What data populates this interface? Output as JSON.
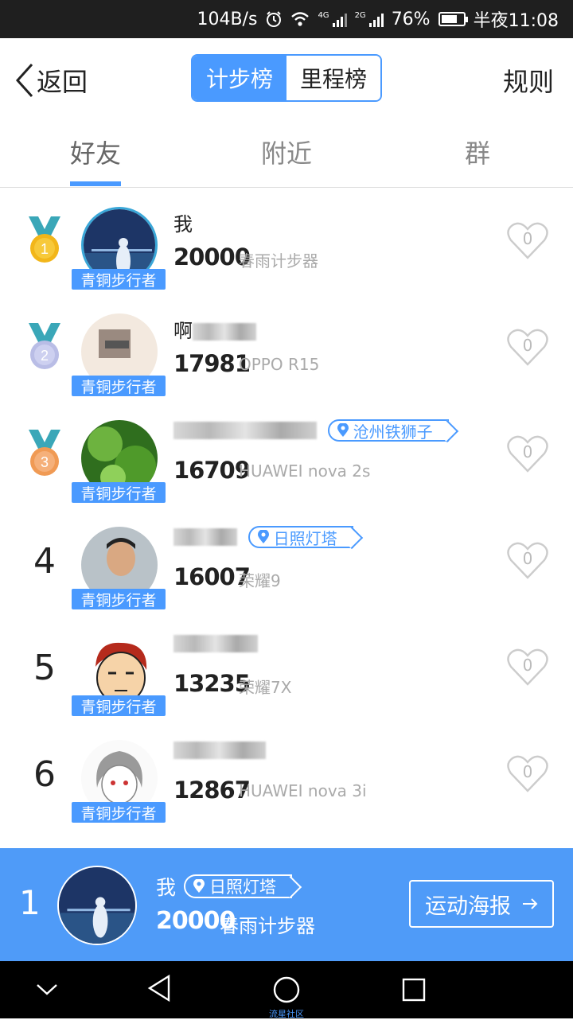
{
  "status_bar": {
    "network_speed": "104B/s",
    "net_4g": "4G",
    "net_2g": "2G",
    "battery": "76%",
    "battery_level": 0.76,
    "time": "半夜11:08"
  },
  "header": {
    "back_label": "返回",
    "seg_left": "计步榜",
    "seg_right": "里程榜",
    "rules": "规则"
  },
  "tabs": [
    {
      "label": "好友"
    },
    {
      "label": "附近"
    },
    {
      "label": "群"
    }
  ],
  "badge_label": "青铜步行者",
  "rows": [
    {
      "rank": "1",
      "name": "我",
      "steps": "20000",
      "device": "春雨计步器",
      "location": "",
      "likes": "0"
    },
    {
      "rank": "2",
      "name": "啊",
      "steps": "17981",
      "device": "OPPO R15",
      "location": "",
      "likes": "0"
    },
    {
      "rank": "3",
      "name": "",
      "steps": "16709",
      "device": "HUAWEI nova 2s",
      "location": "沧州铁狮子",
      "likes": "0"
    },
    {
      "rank": "4",
      "name": "",
      "steps": "16007",
      "device": "荣耀9",
      "location": "日照灯塔",
      "likes": "0"
    },
    {
      "rank": "5",
      "name": "",
      "steps": "13235",
      "device": "荣耀7X",
      "location": "",
      "likes": "0"
    },
    {
      "rank": "6",
      "name": "",
      "steps": "12867",
      "device": "HUAWEI nova 3i",
      "location": "",
      "likes": "0"
    }
  ],
  "me": {
    "rank": "1",
    "name": "我",
    "location": "日照灯塔",
    "steps": "20000",
    "device": "春雨计步器",
    "poster_label": "运动海报"
  },
  "nav": {
    "watermark": "流星社区"
  },
  "colors": {
    "accent": "#4a9aff",
    "bar": "#4f9bf8",
    "gold": "#f2b61a",
    "silver": "#b9bde6",
    "bronze": "#f09a54"
  }
}
